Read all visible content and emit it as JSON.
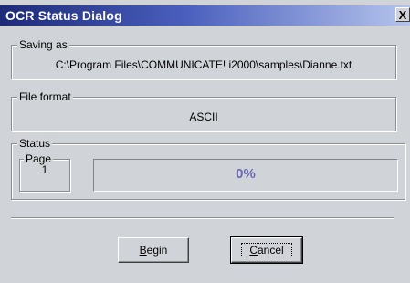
{
  "window": {
    "title": "OCR Status Dialog",
    "close_glyph": "X"
  },
  "saving": {
    "label": "Saving as",
    "path": "C:\\Program Files\\COMMUNICATE! i2000\\samples\\Dianne.txt"
  },
  "file_format": {
    "label": "File format",
    "value": "ASCII"
  },
  "status": {
    "label": "Status",
    "page_label": "Page",
    "page_number": "1",
    "progress_text": "0%",
    "progress_fraction": 0
  },
  "buttons": {
    "begin_mnemonic": "B",
    "begin_rest": "egin",
    "cancel_mnemonic": "C",
    "cancel_rest": "ancel"
  },
  "colors": {
    "title_start": "#1c2a78",
    "title_end": "#b5c4ec",
    "face": "#d0d4d8",
    "progress_text": "#6a6ab0"
  }
}
